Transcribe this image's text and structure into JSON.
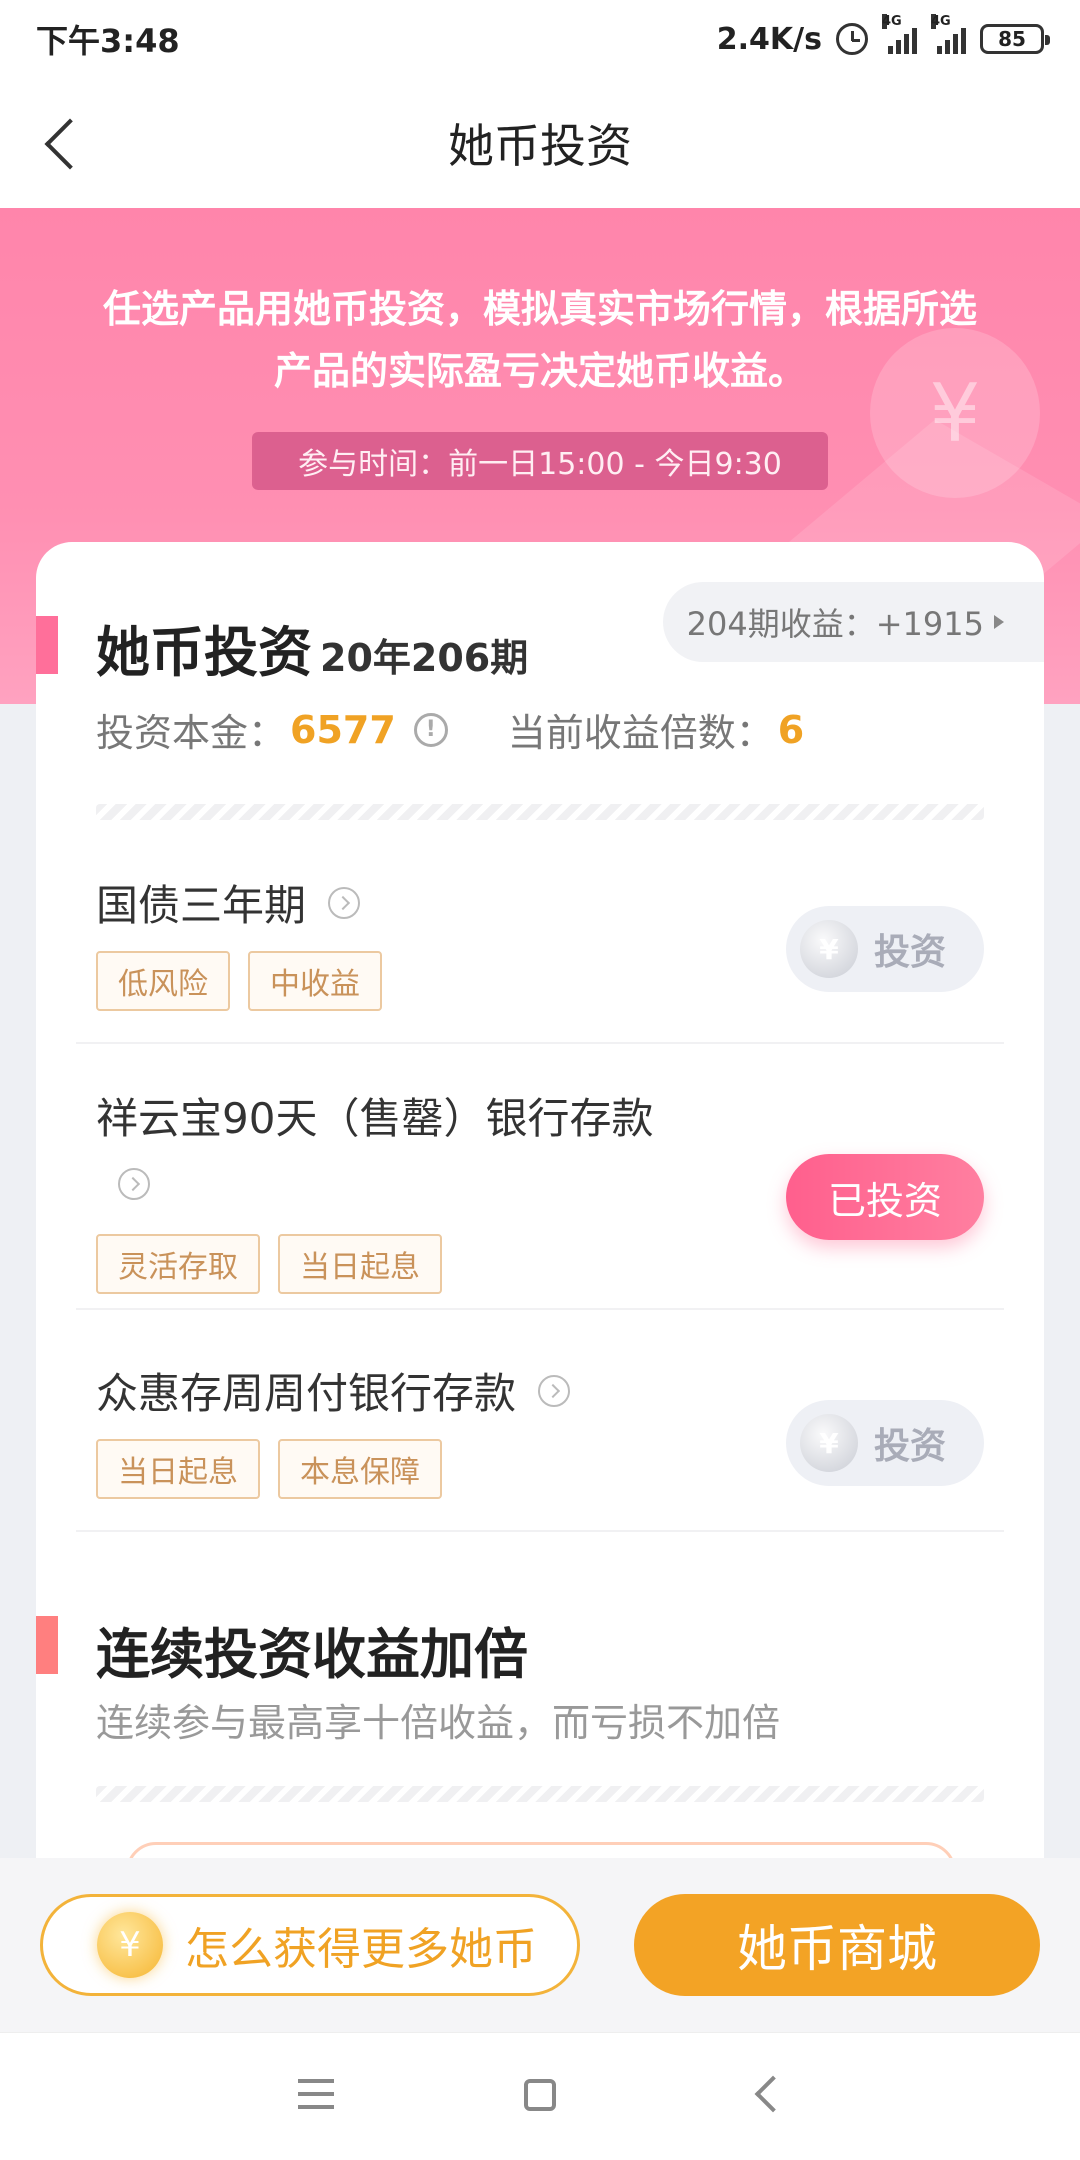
{
  "status_bar": {
    "time": "下午3:48",
    "network_speed": "2.4K/s",
    "sim1_label": "4G",
    "sim2_label": "4G",
    "battery": "85"
  },
  "nav": {
    "title": "她币投资"
  },
  "banner": {
    "text": "任选产品用她币投资，模拟真实市场行情，根据所选产品的实际盈亏决定她币收益。",
    "time_label": "参与时间：前一日15:00 - 今日9:30",
    "coin_symbol": "¥"
  },
  "invest_section": {
    "title": "她币投资",
    "period": "20年206期",
    "last_period_earnings": "204期收益：+1915",
    "principal_label": "投资本金：",
    "principal_value": "6577",
    "multiplier_label": "当前收益倍数：",
    "multiplier_value": "6"
  },
  "products": [
    {
      "name": "国债三年期",
      "tags": [
        "低风险",
        "中收益"
      ],
      "button": "投资",
      "invested": false
    },
    {
      "name": "祥云宝90天（售罄）银行存款",
      "tags": [
        "灵活存取",
        "当日起息"
      ],
      "button": "已投资",
      "invested": true
    },
    {
      "name": "众惠存周周付银行存款",
      "tags": [
        "当日起息",
        "本息保障"
      ],
      "button": "投资",
      "invested": false
    }
  ],
  "bonus_section": {
    "title": "连续投资收益加倍",
    "desc": "连续参与最高享十倍收益，而亏损不加倍"
  },
  "bottom": {
    "earn_more": "怎么获得更多她币",
    "mall": "她币商城",
    "coin_symbol": "¥"
  },
  "colors": {
    "banner_pink": "#ff85ab",
    "accent_pink": "#ff6f9a",
    "gold": "#f0a224",
    "tag_text": "#c9925a"
  }
}
